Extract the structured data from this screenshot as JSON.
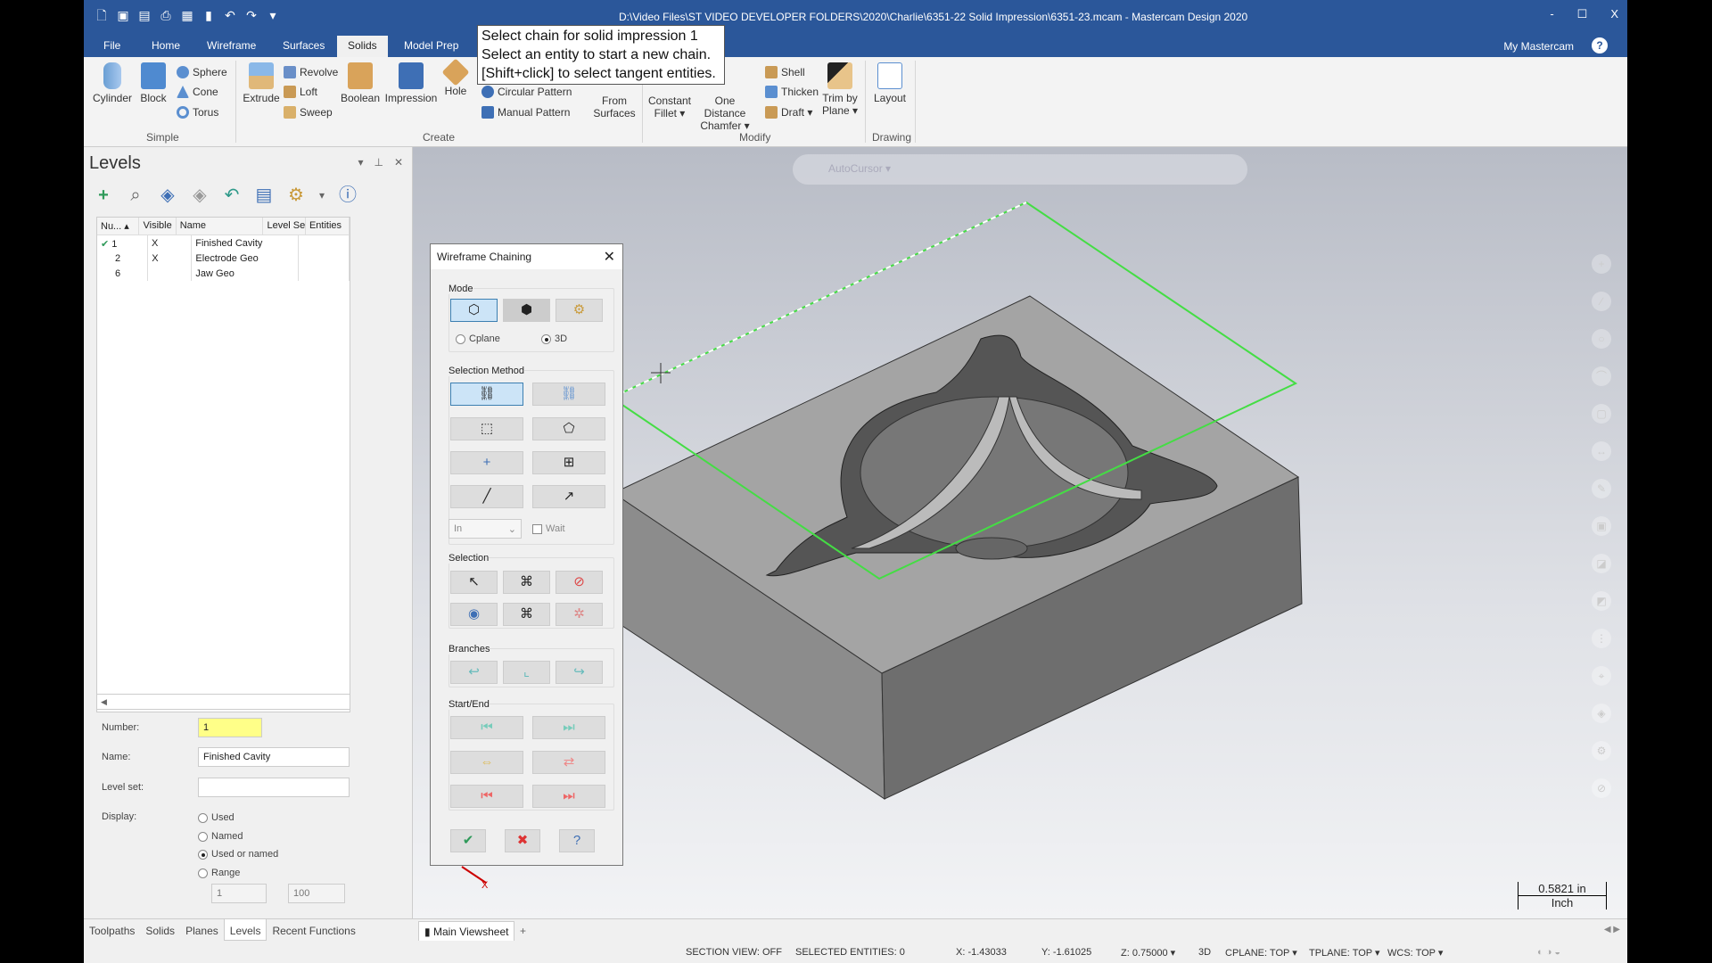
{
  "window": {
    "title": "D:\\Video Files\\ST VIDEO DEVELOPER FOLDERS\\2020\\Charlie\\6351-22 Solid Impression\\6351-23.mcam - Mastercam Design 2020",
    "minimize": "-",
    "maximize": "☐",
    "close": "X"
  },
  "tabs": [
    "File",
    "Home",
    "Wireframe",
    "Surfaces",
    "Solids",
    "Model Prep"
  ],
  "active_tab": "Solids",
  "my_mastercam": "My Mastercam",
  "tooltip": [
    "Select chain for solid impression 1",
    "Select an entity to start a new chain.",
    "[Shift+click] to select tangent entities."
  ],
  "ribbon": {
    "simple": {
      "cylinder": "Cylinder",
      "block": "Block",
      "sphere": "Sphere",
      "cone": "Cone",
      "torus": "Torus",
      "group": "Simple"
    },
    "create": {
      "extrude": "Extrude",
      "revolve": "Revolve",
      "loft": "Loft",
      "sweep": "Sweep",
      "boolean": "Boolean",
      "impression": "Impression",
      "hole": "Hole",
      "circular": "Circular Pattern",
      "manual": "Manual Pattern",
      "from_surfaces": "From Surfaces",
      "group": "Create"
    },
    "modify": {
      "fillet": "Constant Fillet ▾",
      "chamfer": "One Distance Chamfer ▾",
      "shell": "Shell",
      "thicken": "Thicken",
      "draft": "Draft ▾",
      "trim": "Trim by Plane ▾",
      "group": "Modify"
    },
    "drawing": {
      "layout": "Layout",
      "group": "Drawing"
    }
  },
  "levels": {
    "title": "Levels",
    "columns": [
      "Nu...",
      "Visible",
      "Name",
      "Level Set",
      "Entities"
    ],
    "rows": [
      {
        "num": "1",
        "visible": "X",
        "name": "Finished Cavity",
        "active": true
      },
      {
        "num": "2",
        "visible": "X",
        "name": "Electrode Geo"
      },
      {
        "num": "6",
        "visible": "",
        "name": "Jaw Geo"
      }
    ],
    "number_label": "Number:",
    "number": "1",
    "name_label": "Name:",
    "name": "Finished Cavity",
    "levelset_label": "Level set:",
    "levelset": "",
    "display_label": "Display:",
    "display_options": [
      "Used",
      "Named",
      "Used or named",
      "Range"
    ],
    "display_selected": "Used or named",
    "range_from": "1",
    "range_to": "100"
  },
  "bottom_tabs": [
    "Toolpaths",
    "Solids",
    "Planes",
    "Levels",
    "Recent Functions"
  ],
  "active_bottom_tab": "Levels",
  "dialog": {
    "title": "Wireframe Chaining",
    "mode": "Mode",
    "cplane": "Cplane",
    "threed": "3D",
    "mode_selected": "3D",
    "selection_method": "Selection Method",
    "in": "In",
    "wait": "Wait",
    "selection": "Selection",
    "branches": "Branches",
    "start_end": "Start/End"
  },
  "viewport": {
    "autocursor": "AutoCursor",
    "scale_value": "0.5821 in",
    "scale_unit": "Inch",
    "axis": "X"
  },
  "viewsheet": {
    "tab": "Main Viewsheet",
    "add": "+"
  },
  "status": {
    "section": "SECTION VIEW: OFF",
    "selected": "SELECTED ENTITIES: 0",
    "x": "X:  -1.43033",
    "y": "Y:  -1.61025",
    "z": "Z:  0.75000 ▾",
    "mode": "3D",
    "cplane": "CPLANE: TOP ▾",
    "tplane": "TPLANE: TOP ▾",
    "wcs": "WCS: TOP ▾"
  },
  "colors": {
    "titlebar": "#2b579a",
    "chain_plane": "#44dd44",
    "accent": "#3c7fb1"
  }
}
